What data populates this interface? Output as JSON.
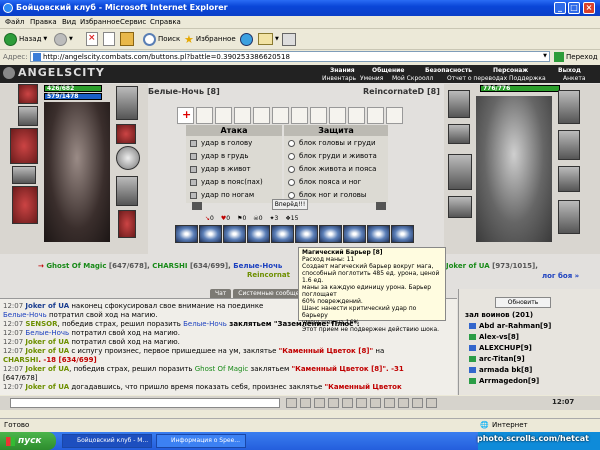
{
  "window": {
    "title": "Бойцовский клуб - Microsoft Internet Explorer"
  },
  "menu": [
    "Файл",
    "Правка",
    "Вид",
    "Избранное",
    "Сервис",
    "Справка"
  ],
  "toolbar": {
    "back": "Назад",
    "search": "Поиск",
    "favorites": "Избранное"
  },
  "address": {
    "label": "Адрес:",
    "url": "http://angelscity.combats.com/buttons.pl?battle=0.390253386620518",
    "go": "Переход"
  },
  "site": {
    "logo": "ANGELSCITY",
    "nav_top": [
      "Знания",
      "Общение",
      "Безопасность",
      "Персонаж",
      "Выход"
    ],
    "nav_bottom": [
      "Инвентарь",
      "Умения",
      "Мой Скроолл",
      "Отчет о переводах",
      "Поддержка",
      "Анкета"
    ]
  },
  "player_left": {
    "hp": "426/682",
    "mana": "579/1478",
    "name": "Белые-Ночь [8]"
  },
  "player_right": {
    "hp": "776/776",
    "name": "ReincornateD [8]"
  },
  "attack": {
    "title": "Атака",
    "options": [
      "удар в голову",
      "удар в грудь",
      "удар в живот",
      "удар в пояс(пах)",
      "удар по ногам"
    ]
  },
  "defense": {
    "title": "Защита",
    "options": [
      "блок головы и груди",
      "блок груди и живота",
      "блок живота и пояса",
      "блок пояса и ног",
      "блок ног и головы"
    ]
  },
  "forward_button": "Вперёд!!!",
  "counters": [
    "0",
    "0",
    "0",
    "0",
    "3",
    "15"
  ],
  "tooltip": {
    "title": "Магический Барьер [8]",
    "lines": [
      "Расход маны: 11",
      "Создает магический барьер вокруг мага,",
      "способный поглотить 485 ед. урона, ценой 1.6 ед.",
      "маны за каждую единицу урона. Барьер поглощает",
      "60% повреждений.",
      "Шанс нанести критический удар по барьеру",
      "уменьшен на 16%",
      "Этот прием не подвержен действию шока."
    ]
  },
  "roster": {
    "arrow": "→",
    "p1": "Ghost Of Magic",
    "p1_hp": "[647/678],",
    "p2": "CHARSHI",
    "p2_hp": "[634/699],",
    "p3": "Белые-Ночь",
    "p4": "Joker of UA",
    "p4_hp": "[973/1015],",
    "line2_left": "Reincornat",
    "line2_right": "лог боя »"
  },
  "tabs": [
    "Чат",
    "Системные сообщения"
  ],
  "chat": [
    {
      "time": "12:07",
      "name": "Joker of UA",
      "text": " наконец сфокусировал свое внимание на поединке"
    },
    {
      "time": "",
      "name": "Белые-Ночь",
      "text": " потратил свой ход на магию."
    },
    {
      "time": "12:07",
      "name": "SENSOR",
      "text": ", победив страх, решил поразить ",
      "target": "Белые-Ночь",
      "tail": " заклятьем \"Заземление: Плюс\"."
    },
    {
      "time": "12:07",
      "name": "Белые-Ночь",
      "text": " потратил свой ход на магию."
    },
    {
      "time": "12:07",
      "name": "Joker of UA",
      "text": " потратил свой ход на магию."
    },
    {
      "time": "12:07",
      "name": "Joker of UA",
      "text": " с испугу произнес, первое пришедшее на ум, заклятье ",
      "spell": "\"Каменный Цветок [8]\"",
      "tail": " на"
    },
    {
      "time": "",
      "name": "CHARSHI",
      "text": ". -18 [634/699]"
    },
    {
      "time": "12:07",
      "name": "Joker of UA",
      "text": ", победив страх, решил поразить ",
      "target": "Ghost Of Magic",
      "tail": " заклятьем ",
      "spell": "\"Каменный Цветок [8]\"",
      "tail2": ". -31"
    },
    {
      "time": "",
      "name": "",
      "text": "[647/678]"
    },
    {
      "time": "12:07",
      "name": "Joker of UA",
      "text": " догадавшись, что пришло время показать себя, произнес заклятье ",
      "spell": "\"Каменный Цветок"
    }
  ],
  "online": {
    "refresh": "Обновить",
    "header": "зал воинов (201)",
    "users": [
      "Abd ar-Rahman[9]",
      "Alex-vs[8]",
      "ALEXCHUP[9]",
      "arc-Titan[9]",
      "armada bk[8]",
      "Arrmagedon[9]"
    ]
  },
  "clock": "12:07",
  "status": {
    "done": "Готово",
    "zone": "Интернет"
  },
  "taskbar": {
    "start": "пуск",
    "tasks": [
      "Бойцовский клуб - M...",
      "Информация о Spee..."
    ]
  },
  "watermark": "photo.scrolls.com/hetcat"
}
